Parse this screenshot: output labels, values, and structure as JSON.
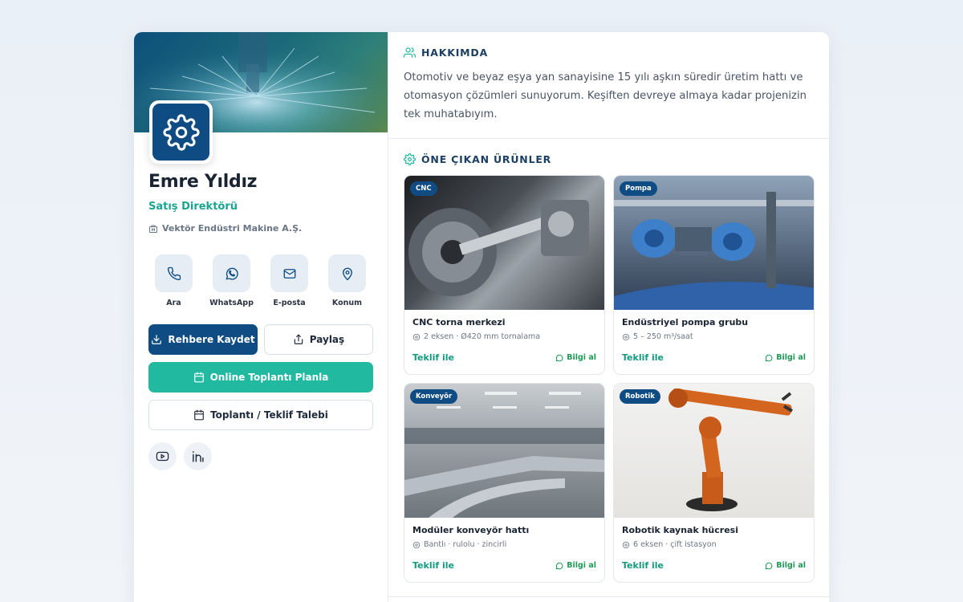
{
  "profile": {
    "name": "Emre Yıldız",
    "title": "Satış Direktörü",
    "company": "Vektör Endüstri Makine A.Ş."
  },
  "actions": [
    {
      "label": "Ara",
      "icon": "phone-icon"
    },
    {
      "label": "WhatsApp",
      "icon": "whatsapp-icon"
    },
    {
      "label": "E-posta",
      "icon": "mail-icon"
    },
    {
      "label": "Konum",
      "icon": "location-pin-icon"
    }
  ],
  "buttons": {
    "save": "Rehbere Kaydet",
    "share": "Paylaş",
    "meeting": "Online Toplantı Planla",
    "request": "Toplantı / Teklif Talebi"
  },
  "socials": [
    {
      "icon": "youtube-icon"
    },
    {
      "icon": "linkedin-icon"
    }
  ],
  "about": {
    "heading": "HAKKIMDA",
    "text": "Otomotiv ve beyaz eşya yan sanayisine 15 yılı aşkın süredir üretim hattı ve otomasyon çözümleri sunuyorum. Keşiften devreye almaya kadar projenizin tek muhatabıyım."
  },
  "products": {
    "heading": "ÖNE ÇIKAN ÜRÜNLER",
    "items": [
      {
        "badge": "CNC",
        "name": "CNC torna merkezi",
        "spec": "2 eksen · Ø420 mm tornalama",
        "quote": "Teklif ile",
        "info": "Bilgi al"
      },
      {
        "badge": "Pompa",
        "name": "Endüstriyel pompa grubu",
        "spec": "5 – 250 m³/saat",
        "quote": "Teklif ile",
        "info": "Bilgi al"
      },
      {
        "badge": "Konveyör",
        "name": "Modüler konveyör hattı",
        "spec": "Bantlı · rulolu · zincirli",
        "quote": "Teklif ile",
        "info": "Bilgi al"
      },
      {
        "badge": "Robotik",
        "name": "Robotik kaynak hücresi",
        "spec": "6 eksen · çift istasyon",
        "quote": "Teklif ile",
        "info": "Bilgi al"
      }
    ]
  },
  "colors": {
    "brand": "#0e4c83",
    "accent": "#22b9a1",
    "whatsapp": "#1e9a55"
  }
}
